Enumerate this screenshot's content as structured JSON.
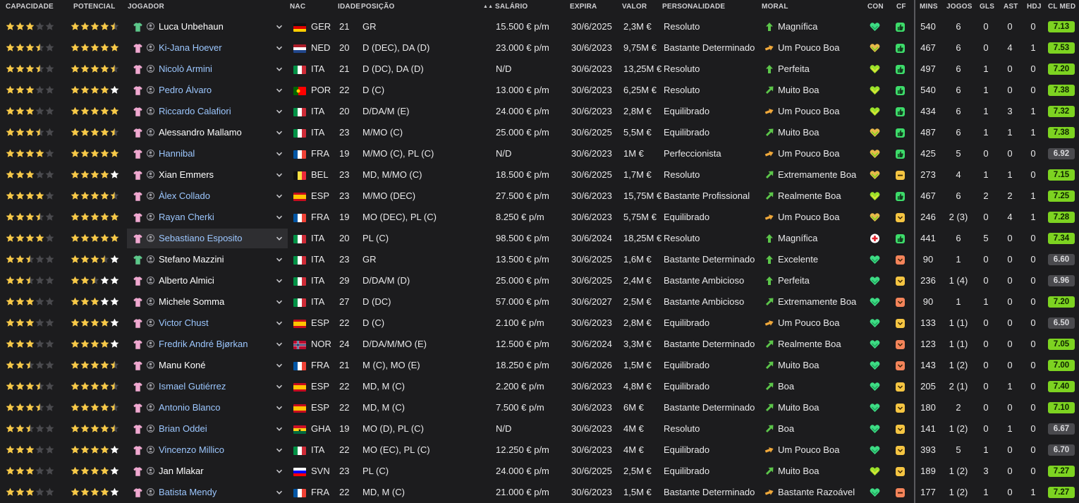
{
  "headers": {
    "capacidade": "CAPACIDADE",
    "potencial": "POTENCIAL",
    "jogador": "JOGADOR",
    "nac": "NAC",
    "idade": "IDADE",
    "posicao": "POSIÇÃO",
    "salario": "SALÁRIO",
    "expira": "EXPIRA",
    "valor": "VALOR",
    "personalidade": "PERSONALIDADE",
    "moral": "MORAL",
    "con": "CON",
    "cf": "CF",
    "mins": "MINS",
    "jogos": "JOGOS",
    "gls": "GLS",
    "ast": "AST",
    "hdj": "HDJ",
    "clmed": "CL MED"
  },
  "sort_indicator": "▲▲",
  "colors": {
    "background": "#1c1c1e",
    "link": "#9cc7ff",
    "star_gold": "#f7c948",
    "star_empty": "#4a4a4e",
    "rating_good": "#7dd321",
    "rating_neutral": "#4a4a4e",
    "morale_up": "#5cc64a",
    "morale_mid": "#f0a83a"
  },
  "players": [
    {
      "ability": 3,
      "potential": 4.5,
      "kit": "gk",
      "name": "Luca Unbehaun",
      "link": false,
      "nat": "GER",
      "flag": "GER",
      "age": "21",
      "pos": "GR",
      "salary": "15.500 € p/m",
      "expires": "30/6/2025",
      "value": "2,3M €",
      "personality": "Resoluto",
      "morale": "Magnífica",
      "morale_icon": "up",
      "con": "green",
      "cf": "thumb",
      "mins": "540",
      "apps": "6",
      "gls": "0",
      "ast": "0",
      "pom": "0",
      "avg": "7.13",
      "avg_good": true
    },
    {
      "ability": 3.5,
      "potential": 5,
      "kit": "pink",
      "name": "Ki-Jana Hoever",
      "link": true,
      "nat": "NED",
      "flag": "NED",
      "age": "20",
      "pos": "D (DEC), DA (D)",
      "salary": "23.000 € p/m",
      "expires": "30/6/2023",
      "value": "9,75M €",
      "personality": "Bastante Determinado",
      "morale": "Um Pouco Boa",
      "morale_icon": "mid",
      "con": "yellowgreen",
      "cf": "thumb",
      "mins": "467",
      "apps": "6",
      "gls": "0",
      "ast": "4",
      "pom": "1",
      "avg": "7.53",
      "avg_good": true
    },
    {
      "ability": 3.5,
      "potential": 4.5,
      "kit": "pink",
      "name": "Nicolò Armini",
      "link": true,
      "nat": "ITA",
      "flag": "ITA",
      "age": "21",
      "pos": "D (DC), DA (D)",
      "salary": "N/D",
      "expires": "30/6/2023",
      "value": "13,25M €",
      "personality": "Resoluto",
      "morale": "Perfeita",
      "morale_icon": "up",
      "con": "lime",
      "cf": "thumb",
      "mins": "497",
      "apps": "6",
      "gls": "1",
      "ast": "0",
      "pom": "0",
      "avg": "7.20",
      "avg_good": true
    },
    {
      "ability": 3,
      "potential": 4,
      "kit": "pink",
      "name": "Pedro Álvaro",
      "link": true,
      "nat": "POR",
      "flag": "POR",
      "age": "22",
      "pos": "D (C)",
      "salary": "13.000 € p/m",
      "expires": "30/6/2023",
      "value": "6,25M €",
      "personality": "Resoluto",
      "morale": "Muito Boa",
      "morale_icon": "upright",
      "con": "lime",
      "cf": "thumb",
      "mins": "540",
      "apps": "6",
      "gls": "1",
      "ast": "0",
      "pom": "0",
      "avg": "7.38",
      "avg_good": true
    },
    {
      "ability": 3,
      "potential": 5,
      "kit": "pink",
      "name": "Riccardo Calafiori",
      "link": true,
      "nat": "ITA",
      "flag": "ITA",
      "age": "20",
      "pos": "D/DA/M (E)",
      "salary": "24.000 € p/m",
      "expires": "30/6/2023",
      "value": "2,8M €",
      "personality": "Equilibrado",
      "morale": "Um Pouco Boa",
      "morale_icon": "mid",
      "con": "lime",
      "cf": "thumb",
      "mins": "434",
      "apps": "6",
      "gls": "1",
      "ast": "3",
      "pom": "1",
      "avg": "7.32",
      "avg_good": true
    },
    {
      "ability": 3.5,
      "potential": 4.5,
      "kit": "pink",
      "name": "Alessandro Mallamo",
      "link": false,
      "nat": "ITA",
      "flag": "ITA",
      "age": "23",
      "pos": "M/MO (C)",
      "salary": "25.000 € p/m",
      "expires": "30/6/2025",
      "value": "5,5M €",
      "personality": "Equilibrado",
      "morale": "Muito Boa",
      "morale_icon": "upright",
      "con": "yellowgreen",
      "cf": "thumb",
      "mins": "487",
      "apps": "6",
      "gls": "1",
      "ast": "1",
      "pom": "1",
      "avg": "7.38",
      "avg_good": true
    },
    {
      "ability": 4,
      "potential": 5,
      "kit": "pink",
      "name": "Hannibal",
      "link": true,
      "nat": "FRA",
      "flag": "FRA",
      "age": "19",
      "pos": "M/MO (C), PL (C)",
      "salary": "N/D",
      "expires": "30/6/2023",
      "value": "1M €",
      "personality": "Perfeccionista",
      "morale": "Um Pouco Boa",
      "morale_icon": "mid",
      "con": "yellowgreen",
      "cf": "thumb",
      "mins": "425",
      "apps": "5",
      "gls": "0",
      "ast": "0",
      "pom": "0",
      "avg": "6.92",
      "avg_good": false
    },
    {
      "ability": 3,
      "potential": 4,
      "kit": "pink",
      "name": "Xian Emmers",
      "link": false,
      "nat": "BEL",
      "flag": "BEL",
      "age": "23",
      "pos": "MD, M/MO (C)",
      "salary": "18.500 € p/m",
      "expires": "30/6/2025",
      "value": "1,7M €",
      "personality": "Resoluto",
      "morale": "Extremamente Boa",
      "morale_icon": "upright",
      "con": "yellowgreen",
      "cf": "minus",
      "mins": "273",
      "apps": "4",
      "gls": "1",
      "ast": "1",
      "pom": "0",
      "avg": "7.15",
      "avg_good": true
    },
    {
      "ability": 4,
      "potential": 4.5,
      "kit": "pink",
      "name": "Àlex Collado",
      "link": true,
      "nat": "ESP",
      "flag": "ESP",
      "age": "23",
      "pos": "M/MO (DEC)",
      "salary": "27.500 € p/m",
      "expires": "30/6/2023",
      "value": "15,75M €",
      "personality": "Bastante Profissional",
      "morale": "Realmente Boa",
      "morale_icon": "upright",
      "con": "lime",
      "cf": "thumb",
      "mins": "467",
      "apps": "6",
      "gls": "2",
      "ast": "2",
      "pom": "1",
      "avg": "7.25",
      "avg_good": true
    },
    {
      "ability": 3.5,
      "potential": 5,
      "kit": "pink",
      "name": "Rayan Cherki",
      "link": true,
      "nat": "FRA",
      "flag": "FRA",
      "age": "19",
      "pos": "MO (DEC), PL (C)",
      "salary": "8.250 € p/m",
      "expires": "30/6/2023",
      "value": "5,75M €",
      "personality": "Equilibrado",
      "morale": "Um Pouco Boa",
      "morale_icon": "mid",
      "con": "yellowgreen",
      "cf": "yellow",
      "mins": "246",
      "apps": "2 (3)",
      "gls": "0",
      "ast": "4",
      "pom": "1",
      "avg": "7.28",
      "avg_good": true
    },
    {
      "ability": 4,
      "potential": 5,
      "kit": "pink",
      "name": "Sebastiano Esposito",
      "link": true,
      "nat": "ITA",
      "flag": "ITA",
      "age": "20",
      "pos": "PL (C)",
      "salary": "98.500 € p/m",
      "expires": "30/6/2024",
      "value": "18,25M €",
      "personality": "Resoluto",
      "morale": "Magnífica",
      "morale_icon": "up",
      "con": "injury",
      "cf": "thumb",
      "mins": "441",
      "apps": "6",
      "gls": "5",
      "ast": "0",
      "pom": "0",
      "avg": "7.34",
      "avg_good": true,
      "hover": true
    },
    {
      "ability": 2.5,
      "potential": 3.5,
      "kit": "gk",
      "name": "Stefano Mazzini",
      "link": false,
      "nat": "ITA",
      "flag": "ITA",
      "age": "23",
      "pos": "GR",
      "salary": "13.500 € p/m",
      "expires": "30/6/2025",
      "value": "1,6M €",
      "personality": "Bastante Determinado",
      "morale": "Excelente",
      "morale_icon": "up",
      "con": "green",
      "cf": "orange",
      "mins": "90",
      "apps": "1",
      "gls": "0",
      "ast": "0",
      "pom": "0",
      "avg": "6.60",
      "avg_good": false
    },
    {
      "ability": 2.5,
      "potential": 2.5,
      "kit": "pink",
      "name": "Alberto Almici",
      "link": false,
      "nat": "ITA",
      "flag": "ITA",
      "age": "29",
      "pos": "D/DA/M (D)",
      "salary": "25.000 € p/m",
      "expires": "30/6/2025",
      "value": "2,4M €",
      "personality": "Bastante Ambicioso",
      "morale": "Perfeita",
      "morale_icon": "up",
      "con": "green",
      "cf": "yellow",
      "mins": "236",
      "apps": "1 (4)",
      "gls": "0",
      "ast": "0",
      "pom": "0",
      "avg": "6.96",
      "avg_good": false
    },
    {
      "ability": 3,
      "potential": 3,
      "kit": "pink",
      "name": "Michele Somma",
      "link": false,
      "nat": "ITA",
      "flag": "ITA",
      "age": "27",
      "pos": "D (DC)",
      "salary": "57.000 € p/m",
      "expires": "30/6/2027",
      "value": "2,5M €",
      "personality": "Bastante Ambicioso",
      "morale": "Extremamente Boa",
      "morale_icon": "upright",
      "con": "green",
      "cf": "orange",
      "mins": "90",
      "apps": "1",
      "gls": "1",
      "ast": "0",
      "pom": "0",
      "avg": "7.20",
      "avg_good": true
    },
    {
      "ability": 3,
      "potential": 4,
      "kit": "pink",
      "name": "Victor Chust",
      "link": true,
      "nat": "ESP",
      "flag": "ESP",
      "age": "22",
      "pos": "D (C)",
      "salary": "2.100 € p/m",
      "expires": "30/6/2023",
      "value": "2,8M €",
      "personality": "Equilibrado",
      "morale": "Um Pouco Boa",
      "morale_icon": "mid",
      "con": "green",
      "cf": "yellow",
      "mins": "133",
      "apps": "1 (1)",
      "gls": "0",
      "ast": "0",
      "pom": "0",
      "avg": "6.50",
      "avg_good": false
    },
    {
      "ability": 3,
      "potential": 4,
      "kit": "pink",
      "name": "Fredrik André Bjørkan",
      "link": true,
      "nat": "NOR",
      "flag": "NOR",
      "age": "24",
      "pos": "D/DA/M/MO (E)",
      "salary": "12.500 € p/m",
      "expires": "30/6/2024",
      "value": "3,3M €",
      "personality": "Bastante Determinado",
      "morale": "Realmente Boa",
      "morale_icon": "upright",
      "con": "green",
      "cf": "orange",
      "mins": "123",
      "apps": "1 (1)",
      "gls": "0",
      "ast": "0",
      "pom": "0",
      "avg": "7.05",
      "avg_good": true
    },
    {
      "ability": 2.5,
      "potential": 4.5,
      "kit": "pink",
      "name": "Manu Koné",
      "link": false,
      "nat": "FRA",
      "flag": "FRA",
      "age": "21",
      "pos": "M (C), MO (E)",
      "salary": "18.250 € p/m",
      "expires": "30/6/2026",
      "value": "1,5M €",
      "personality": "Equilibrado",
      "morale": "Muito Boa",
      "morale_icon": "upright",
      "con": "green",
      "cf": "orange",
      "mins": "143",
      "apps": "1 (2)",
      "gls": "0",
      "ast": "0",
      "pom": "0",
      "avg": "7.00",
      "avg_good": true
    },
    {
      "ability": 3.5,
      "potential": 4.5,
      "kit": "pink",
      "name": "Ismael Gutiérrez",
      "link": true,
      "nat": "ESP",
      "flag": "ESP",
      "age": "22",
      "pos": "MD, M (C)",
      "salary": "2.200 € p/m",
      "expires": "30/6/2023",
      "value": "4,8M €",
      "personality": "Equilibrado",
      "morale": "Boa",
      "morale_icon": "upright",
      "con": "green",
      "cf": "yellow",
      "mins": "205",
      "apps": "2 (1)",
      "gls": "0",
      "ast": "1",
      "pom": "0",
      "avg": "7.40",
      "avg_good": true
    },
    {
      "ability": 3.5,
      "potential": 4.5,
      "kit": "pink",
      "name": "Antonio Blanco",
      "link": true,
      "nat": "ESP",
      "flag": "ESP",
      "age": "22",
      "pos": "MD, M (C)",
      "salary": "7.500 € p/m",
      "expires": "30/6/2023",
      "value": "6M €",
      "personality": "Bastante Determinado",
      "morale": "Muito Boa",
      "morale_icon": "upright",
      "con": "green",
      "cf": "yellow",
      "mins": "180",
      "apps": "2",
      "gls": "0",
      "ast": "0",
      "pom": "0",
      "avg": "7.10",
      "avg_good": true
    },
    {
      "ability": 2.5,
      "potential": 4.5,
      "kit": "pink",
      "name": "Brian Oddei",
      "link": true,
      "nat": "GHA",
      "flag": "GHA",
      "age": "19",
      "pos": "MO (D), PL (C)",
      "salary": "N/D",
      "expires": "30/6/2023",
      "value": "4M €",
      "personality": "Resoluto",
      "morale": "Boa",
      "morale_icon": "upright",
      "con": "green",
      "cf": "yellow",
      "mins": "141",
      "apps": "1 (2)",
      "gls": "0",
      "ast": "1",
      "pom": "0",
      "avg": "6.67",
      "avg_good": false
    },
    {
      "ability": 3,
      "potential": 4,
      "kit": "pink",
      "name": "Vincenzo Millico",
      "link": true,
      "nat": "ITA",
      "flag": "ITA",
      "age": "22",
      "pos": "MO (EC), PL (C)",
      "salary": "12.250 € p/m",
      "expires": "30/6/2023",
      "value": "4M €",
      "personality": "Equilibrado",
      "morale": "Um Pouco Boa",
      "morale_icon": "mid",
      "con": "green",
      "cf": "yellow",
      "mins": "393",
      "apps": "5",
      "gls": "1",
      "ast": "0",
      "pom": "0",
      "avg": "6.70",
      "avg_good": false
    },
    {
      "ability": 3,
      "potential": 4,
      "kit": "pink",
      "name": "Jan Mlakar",
      "link": false,
      "nat": "SVN",
      "flag": "SVN",
      "age": "23",
      "pos": "PL (C)",
      "salary": "24.000 € p/m",
      "expires": "30/6/2025",
      "value": "2,5M €",
      "personality": "Equilibrado",
      "morale": "Muito Boa",
      "morale_icon": "upright",
      "con": "lime",
      "cf": "yellow",
      "mins": "189",
      "apps": "1 (2)",
      "gls": "3",
      "ast": "0",
      "pom": "0",
      "avg": "7.27",
      "avg_good": true
    },
    {
      "ability": 3,
      "potential": 4,
      "kit": "pink",
      "name": "Batista Mendy",
      "link": true,
      "nat": "FRA",
      "flag": "FRA",
      "age": "22",
      "pos": "MD, M (C)",
      "salary": "21.000 € p/m",
      "expires": "30/6/2023",
      "value": "1,5M €",
      "personality": "Bastante Determinado",
      "morale": "Bastante Razoável",
      "morale_icon": "mid",
      "con": "green",
      "cf": "minusorange",
      "mins": "177",
      "apps": "1 (2)",
      "gls": "1",
      "ast": "0",
      "pom": "1",
      "avg": "7.27",
      "avg_good": true
    }
  ]
}
